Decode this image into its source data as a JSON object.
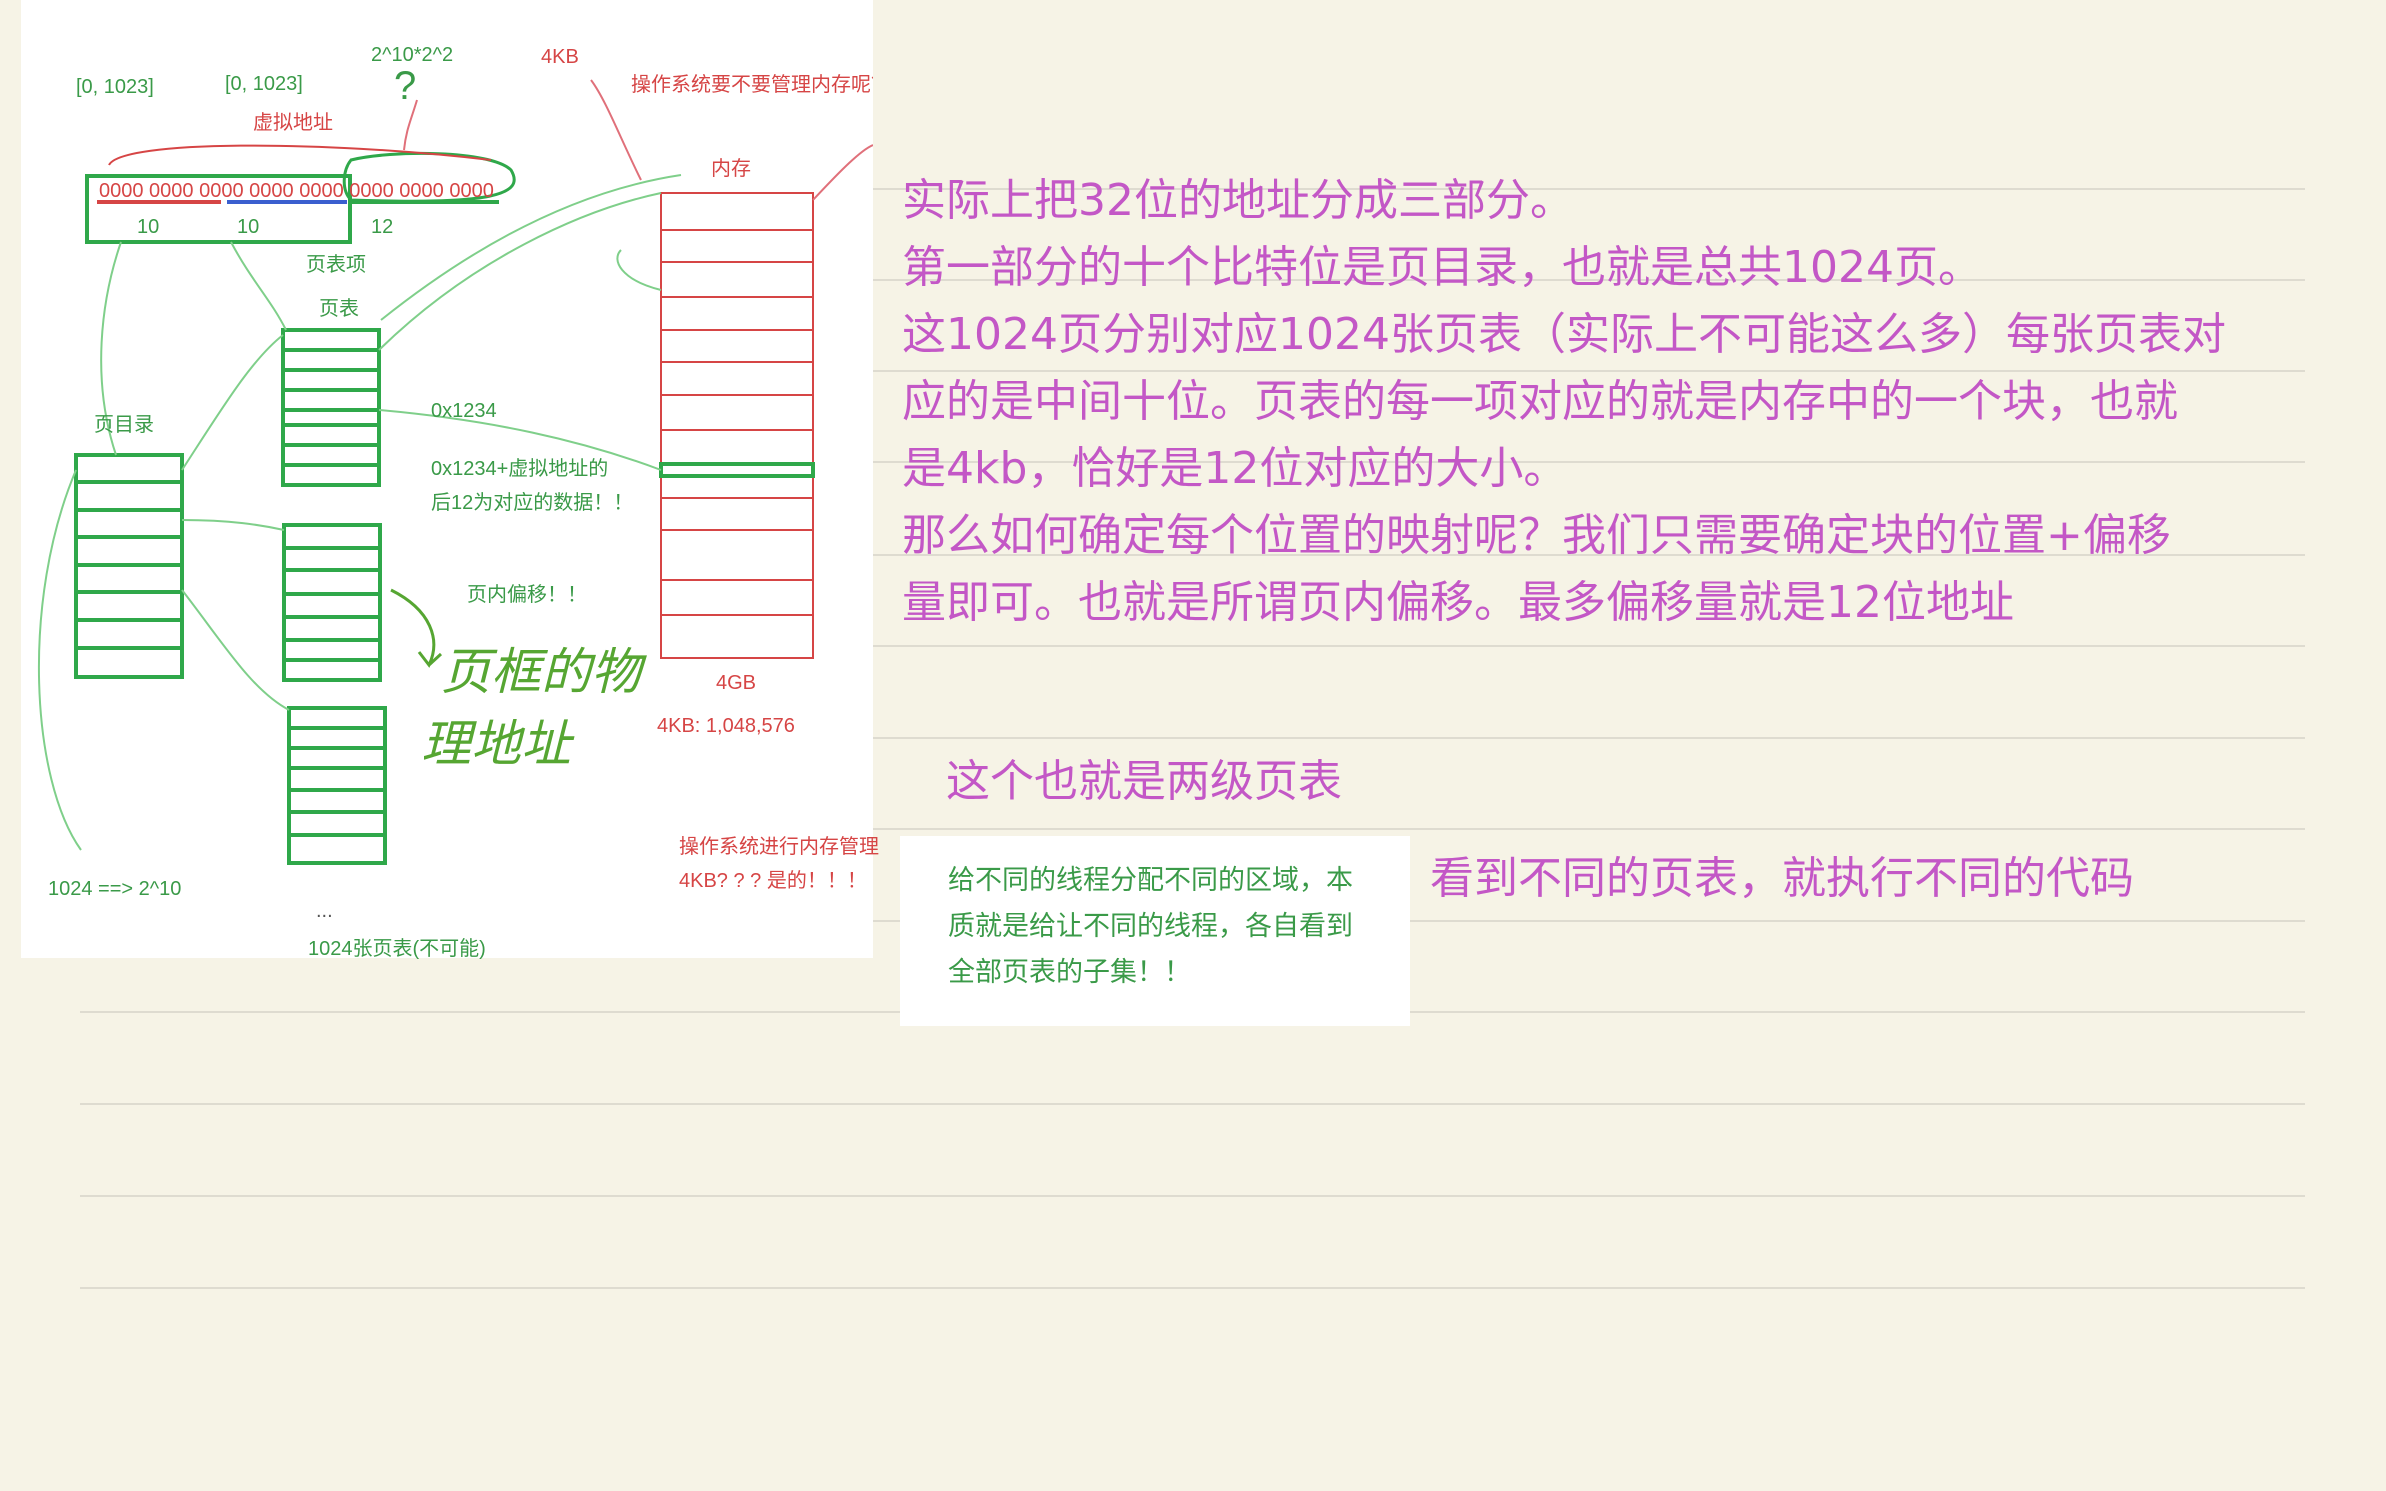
{
  "diagram": {
    "range_label_1": "[0, 1023]",
    "range_label_2": "[0, 1023]",
    "formula_top": "2^10*2^2",
    "question_mark": "?",
    "label_4kb_top": "4KB",
    "os_question": "操作系统要不要管理内存呢？",
    "virtual_address": "虚拟地址",
    "memory_title": "内存",
    "address_bits": "0000 0000 0000 0000 0000 0000 0000 0000",
    "segment_1_bits": "10",
    "segment_2_bits": "10",
    "segment_3_bits": "12",
    "page_table_entry": "页表项",
    "page_table": "页表",
    "page_directory": "页目录",
    "hex_address": "0x1234",
    "offset_note_line1": "0x1234+虚拟地址的",
    "offset_note_line2": "后12为对应的数据！！",
    "page_offset": "页内偏移！！",
    "handwritten_line1": "页框的物",
    "handwritten_line2": "理地址",
    "label_4gb": "4GB",
    "label_4kb_count": "4KB: 1,048,576",
    "os_manages_line1": "操作系统进行内存管理",
    "os_manages_line2": "4KB? ? ? 是的！！！",
    "count_formula": "1024 ==> 2^10",
    "ellipsis": "...",
    "table_count": "1024张页表(不可能)"
  },
  "notes": {
    "lines": [
      "实际上把32位的地址分成三部分。",
      "第一部分的十个比特位是页目录，也就是总共1024页。",
      "这1024页分别对应1024张页表（实际上不可能这么多）每张页表对",
      "应的是中间十位。页表的每一项对应的就是内存中的一个块，也就",
      "是4kb，恰好是12位对应的大小。",
      "那么如何确定每个位置的映射呢？我们只需要确定块的位置+偏移",
      "量即可。也就是所谓页内偏移。最多偏移量就是12位地址"
    ],
    "two_level": "这个也就是两级页表",
    "summary": "看到不同的页表，就执行不同的代码"
  },
  "snippet": {
    "line1": "给不同的线程分配不同的区域，本",
    "line2": "质就是给让不同的线程，各自看到",
    "line3": "全部页表的子集！！"
  },
  "colors": {
    "background": "#f6f3e6",
    "note_text": "#c357c6",
    "diagram_green": "#2fa84a",
    "diagram_red": "#d64545",
    "handwriting_green": "#56a632"
  }
}
